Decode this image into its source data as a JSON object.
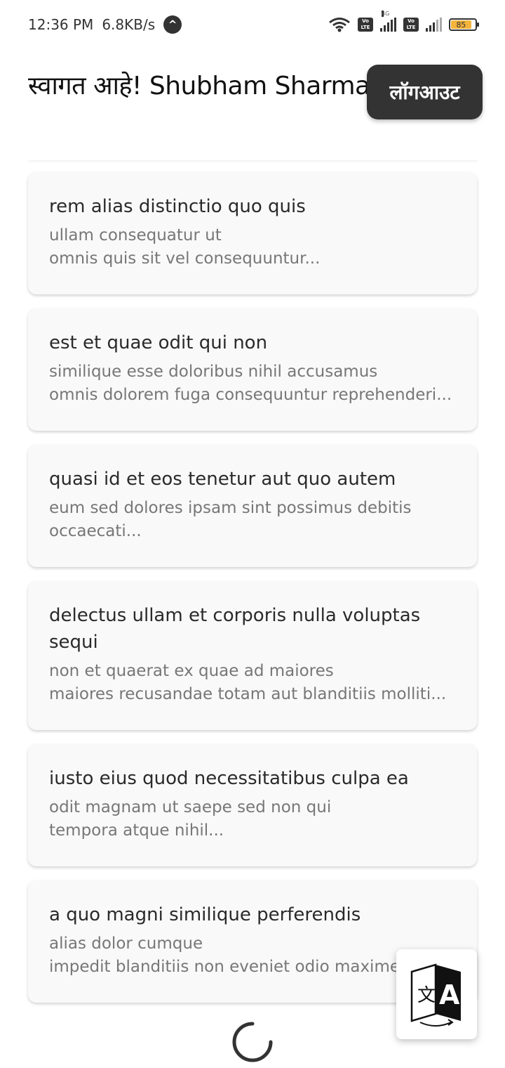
{
  "status_bar": {
    "time": "12:36 PM",
    "net_speed": "6.8KB/s",
    "battery": "85",
    "network_type": "4G",
    "volte_label_top": "Vo",
    "volte_label_bottom": "LTE"
  },
  "header": {
    "welcome_text": "स्वागत आहे! Shubham Sharma",
    "logout_label": "लॉगआउट"
  },
  "posts": [
    {
      "title": "rem alias distinctio quo quis",
      "body": "ullam consequatur ut\nomnis quis sit vel consequuntur..."
    },
    {
      "title": "est et quae odit qui non",
      "body": "similique esse doloribus nihil accusamus\nomnis dolorem fuga consequuntur reprehenderi..."
    },
    {
      "title": "quasi id et eos tenetur aut quo autem",
      "body": "eum sed dolores ipsam sint possimus debitis\noccaecati..."
    },
    {
      "title": "delectus ullam et corporis nulla voluptas sequi",
      "body": "non et quaerat ex quae ad maiores\nmaiores recusandae totam aut blanditiis molliti..."
    },
    {
      "title": "iusto eius quod necessitatibus culpa ea",
      "body": "odit magnam ut saepe sed non qui\ntempora atque nihil..."
    },
    {
      "title": "a quo magni similique perferendis",
      "body": "alias dolor cumque\nimpedit blanditiis non eveniet odio maxime..."
    }
  ],
  "translate_icon": {
    "glyph_left": "文",
    "glyph_right": "A"
  },
  "colors": {
    "logout_bg": "#333333",
    "card_bg": "#f9f9f9",
    "battery": "#f4b43c"
  }
}
